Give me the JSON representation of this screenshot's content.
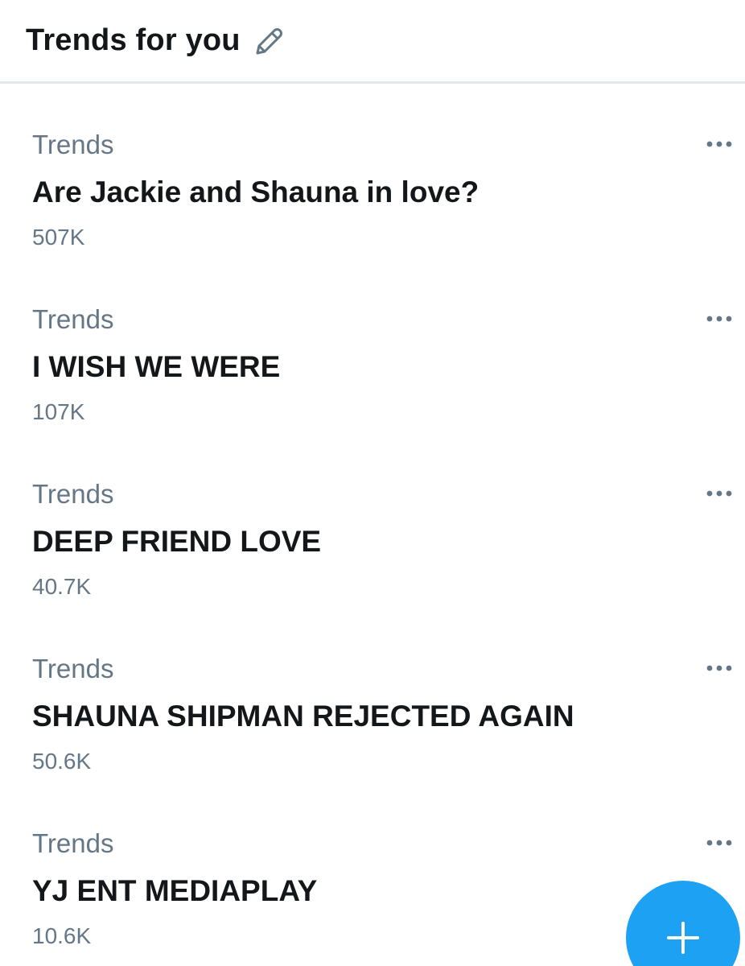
{
  "header": {
    "title": "Trends for you",
    "edit_icon": "pencil-icon"
  },
  "trends": [
    {
      "category": "Trends",
      "title": "Are Jackie and Shauna in love?",
      "count": "507K"
    },
    {
      "category": "Trends",
      "title": "I WISH WE WERE",
      "count": "107K"
    },
    {
      "category": "Trends",
      "title": "DEEP FRIEND LOVE",
      "count": "40.7K"
    },
    {
      "category": "Trends",
      "title": "SHAUNA SHIPMAN REJECTED AGAIN",
      "count": "50.6K"
    },
    {
      "category": "Trends",
      "title": "YJ ENT MEDIAPLAY",
      "count": "10.6K"
    }
  ],
  "more_icon": "more-horizontal-icon",
  "fab": {
    "icon": "plus-icon"
  },
  "colors": {
    "accent": "#1da1f2",
    "text_primary": "#14171a",
    "text_secondary": "#657786",
    "divider": "#e1e8ed"
  }
}
